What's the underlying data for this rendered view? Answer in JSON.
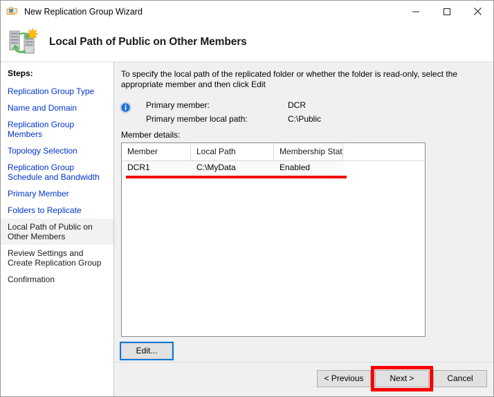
{
  "window": {
    "title": "New Replication Group Wizard",
    "title_icon": "folders-icon",
    "minimize_label": "—",
    "maximize_label": "□",
    "close_label": "✕"
  },
  "banner": {
    "heading": "Local Path of Public on Other Members",
    "icon": "replication-servers-icon"
  },
  "sidebar": {
    "title": "Steps:",
    "items": [
      {
        "label": "Replication Group Type",
        "state": "link"
      },
      {
        "label": "Name and Domain",
        "state": "link"
      },
      {
        "label": "Replication Group Members",
        "state": "link"
      },
      {
        "label": "Topology Selection",
        "state": "link"
      },
      {
        "label": "Replication Group Schedule and Bandwidth",
        "state": "link"
      },
      {
        "label": "Primary Member",
        "state": "link"
      },
      {
        "label": "Folders to Replicate",
        "state": "link"
      },
      {
        "label": "Local Path of Public on Other Members",
        "state": "current"
      },
      {
        "label": "Review Settings and Create Replication Group",
        "state": "plain"
      },
      {
        "label": "Confirmation",
        "state": "plain"
      }
    ]
  },
  "main": {
    "instruction": "To specify the local path of the replicated folder or whether the folder is read-only, select the appropriate member and then click Edit",
    "info_icon": "info-icon",
    "info_rows": [
      {
        "label": "Primary member:",
        "value": "DCR"
      },
      {
        "label": "Primary member local path:",
        "value": "C:\\Public"
      }
    ],
    "member_details_label": "Member details:",
    "table": {
      "columns": [
        "Member",
        "Local Path",
        "Membership Stat..."
      ],
      "rows": [
        [
          "DCR1",
          "C:\\MyData",
          "Enabled"
        ]
      ]
    },
    "edit_button": "Edit..."
  },
  "footer": {
    "previous": "< Previous",
    "next": "Next >",
    "cancel": "Cancel"
  },
  "annotations": {
    "row_underline_color": "#f40000",
    "next_highlight_color": "#fb0000",
    "edit_focus_color": "#0078d7"
  }
}
